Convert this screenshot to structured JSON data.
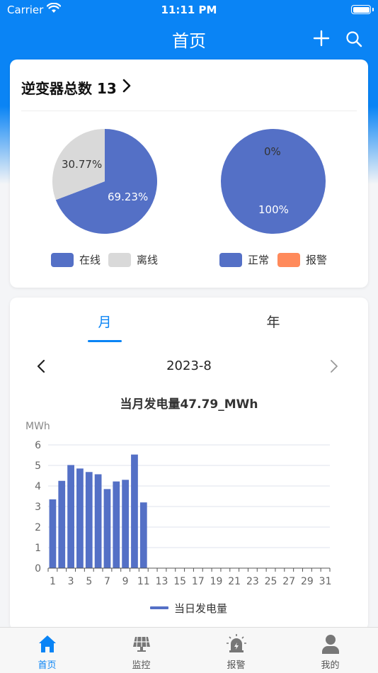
{
  "status_bar": {
    "carrier": "Carrier",
    "time": "11:11 PM"
  },
  "nav": {
    "title": "首页"
  },
  "inverters": {
    "title": "逆变器总数 13",
    "online_pie": {
      "slices": [
        {
          "label": "在线",
          "value": 69.23,
          "text": "69.23%",
          "color": "#5470c6"
        },
        {
          "label": "离线",
          "value": 30.77,
          "text": "30.77%",
          "color": "#d9d9d9"
        }
      ]
    },
    "status_pie": {
      "slices": [
        {
          "label": "正常",
          "value": 100,
          "text": "100%",
          "color": "#5470c6"
        },
        {
          "label": "报警",
          "value": 0,
          "text": "0%",
          "color": "#ff8a5b"
        }
      ]
    }
  },
  "energy": {
    "tabs": [
      {
        "label": "月",
        "active": true
      },
      {
        "label": "年",
        "active": false
      }
    ],
    "period": "2023-8",
    "title": "当月发电量47.79_MWh"
  },
  "chart_data": {
    "type": "bar",
    "unit_label": "MWh",
    "ylim": [
      0,
      6
    ],
    "yticks": [
      0,
      1,
      2,
      3,
      4,
      5,
      6
    ],
    "x": [
      1,
      2,
      3,
      4,
      5,
      6,
      7,
      8,
      9,
      10,
      11,
      12,
      13,
      14,
      15,
      16,
      17,
      18,
      19,
      20,
      21,
      22,
      23,
      24,
      25,
      26,
      27,
      28,
      29,
      30,
      31
    ],
    "xtick_labels": [
      "1",
      "3",
      "5",
      "7",
      "9",
      "11",
      "13",
      "15",
      "17",
      "19",
      "21",
      "23",
      "25",
      "27",
      "29",
      "31"
    ],
    "series": [
      {
        "name": "当日发电量",
        "color": "#5470c6",
        "values": [
          3.35,
          4.25,
          5.02,
          4.85,
          4.68,
          4.57,
          3.85,
          4.22,
          4.3,
          5.53,
          3.2,
          0,
          0,
          0,
          0,
          0,
          0,
          0,
          0,
          0,
          0,
          0,
          0,
          0,
          0,
          0,
          0,
          0,
          0,
          0,
          0
        ]
      }
    ],
    "grid": true,
    "legend": "bottom"
  },
  "tabbar": {
    "items": [
      {
        "label": "首页",
        "icon": "home-icon",
        "active": true
      },
      {
        "label": "监控",
        "icon": "solar-panel-icon",
        "active": false
      },
      {
        "label": "报警",
        "icon": "alarm-light-icon",
        "active": false
      },
      {
        "label": "我的",
        "icon": "user-icon",
        "active": false
      }
    ]
  }
}
